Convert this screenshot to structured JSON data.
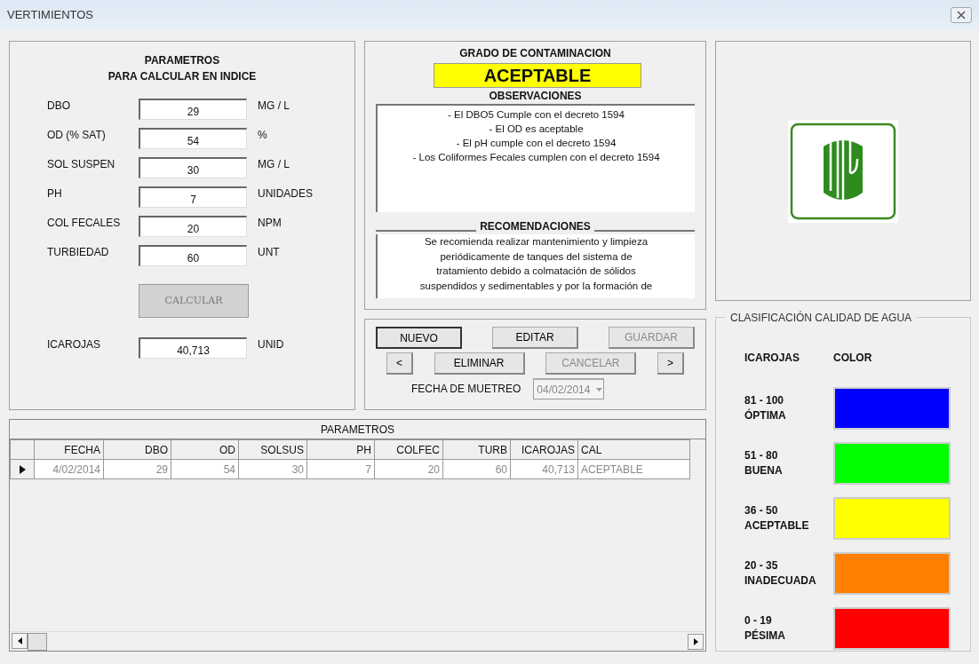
{
  "window": {
    "title": "VERTIMIENTOS"
  },
  "parameters": {
    "title": "PARAMETROS",
    "subtitle": "PARA CALCULAR EN INDICE",
    "fields": [
      {
        "label": "DBO",
        "value": "29",
        "unit": "MG / L"
      },
      {
        "label": "OD (% SAT)",
        "value": "54",
        "unit": "%"
      },
      {
        "label": "SOL SUSPEN",
        "value": "30",
        "unit": "MG / L"
      },
      {
        "label": "PH",
        "value": "7",
        "unit": "UNIDADES"
      },
      {
        "label": "COL FECALES",
        "value": "20",
        "unit": "NPM"
      },
      {
        "label": "TURBIEDAD",
        "value": "60",
        "unit": "UNT"
      }
    ],
    "calculate_button": {
      "label": "CALCULAR",
      "disabled": true
    },
    "result": {
      "label": "ICAROJAS",
      "value": "40,713",
      "unit": "UNID"
    }
  },
  "contamination": {
    "title": "GRADO DE CONTAMINACION",
    "grade": "ACEPTABLE"
  },
  "observations": {
    "title": "OBSERVACIONES",
    "lines": [
      "- El DBO5 Cumple con el decreto 1594",
      "- El OD es aceptable",
      "- El pH cumple con el decreto 1594",
      "- Los Coliformes Fecales cumplen con el decreto 1594"
    ]
  },
  "recommendations": {
    "title": "RECOMENDACIONES",
    "lines": [
      "Se recomienda realizar mantenimiento y limpieza",
      "periódicamente de tanques del sistema de",
      "tratamiento debido a colmatación de sólidos",
      "suspendidos y sedimentables y por la formación de"
    ]
  },
  "actions": {
    "top_buttons": [
      {
        "label": "NUEVO",
        "disabled": false,
        "focused": true
      },
      {
        "label": "EDITAR",
        "disabled": false,
        "focused": false
      },
      {
        "label": "GUARDAR",
        "disabled": true,
        "focused": false
      }
    ],
    "bottom_buttons": [
      {
        "label": "<",
        "disabled": false,
        "focused": false
      },
      {
        "label": "ELIMINAR",
        "disabled": false,
        "focused": false
      },
      {
        "label": "CANCELAR",
        "disabled": true,
        "focused": false
      },
      {
        "label": ">",
        "disabled": false,
        "focused": false
      }
    ],
    "sample_date": {
      "label": "FECHA DE MUETREO",
      "value": "04/02/2014",
      "disabled": true
    }
  },
  "classification": {
    "title": "CLASIFICACIÓN CALIDAD DE AGUA",
    "headers": [
      "ICAROJAS",
      "COLOR"
    ],
    "classes": [
      {
        "range": "81 - 100",
        "name": "ÓPTIMA",
        "color": "#0000ff"
      },
      {
        "range": "51 - 80",
        "name": "BUENA",
        "color": "#00ff00"
      },
      {
        "range": "36 - 50",
        "name": "ACEPTABLE",
        "color": "#ffff00"
      },
      {
        "range": "20 - 35",
        "name": "INADECUADA",
        "color": "#ff8000"
      },
      {
        "range": "0 - 19",
        "name": "PÉSIMA",
        "color": "#ff0000"
      }
    ]
  },
  "table": {
    "title": "PARAMETROS",
    "columns": [
      "FECHA",
      "DBO",
      "OD",
      "SOLSUS",
      "PH",
      "COLFEC",
      "TURB",
      "ICAROJAS",
      "CAL"
    ],
    "rows": [
      {
        "current": true,
        "cells": [
          "4/02/2014",
          "29",
          "54",
          "30",
          "7",
          "20",
          "60",
          "40,713",
          "ACEPTABLE"
        ]
      }
    ]
  }
}
